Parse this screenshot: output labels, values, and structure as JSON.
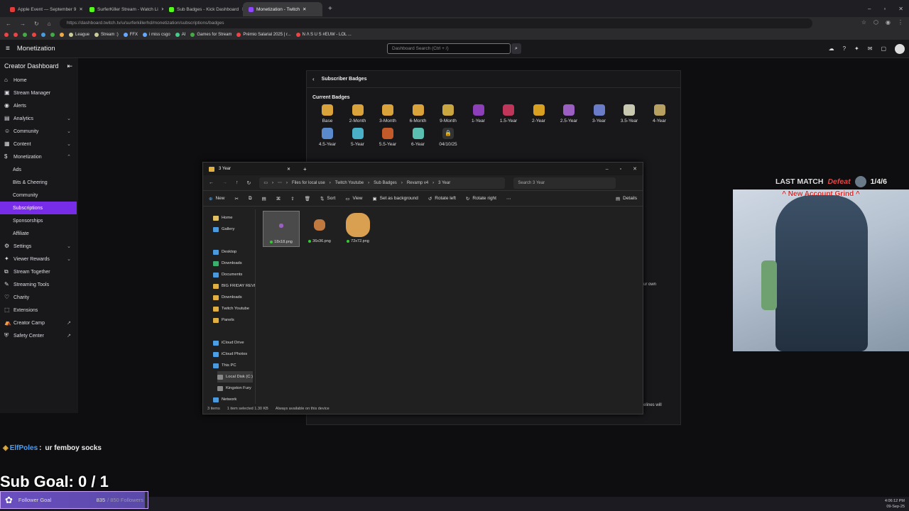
{
  "browser": {
    "tabs": [
      {
        "label": "Apple Event — September 9",
        "color": "#e43b3b"
      },
      {
        "label": "SurferKiller Stream - Watch Li",
        "color": "#53fc18"
      },
      {
        "label": "Sub Badges - Kick Dashboard",
        "color": "#53fc18"
      },
      {
        "label": "Monetization - Twitch",
        "color": "#9147ff"
      }
    ],
    "url": "https://dashboard.twitch.tv/u/surferkillerhd/monetization/subscriptions/badges",
    "bookmarks": [
      "League",
      "Stream :)",
      "FFX",
      "i miss csgo",
      "AI",
      "Games for Stream",
      "Prémio Salarial 2025 | r...",
      "N Λ S U S #EUW - LOL ..."
    ]
  },
  "twitch": {
    "header_title": "Monetization",
    "search_placeholder": "Dashboard Search (Ctrl + /)",
    "sidebar_title": "Creator Dashboard",
    "sidebar": [
      {
        "label": "Home",
        "icon": "home-icon",
        "glyph": "⌂"
      },
      {
        "label": "Stream Manager",
        "icon": "stream-manager-icon",
        "glyph": "▣"
      },
      {
        "label": "Alerts",
        "icon": "alerts-icon",
        "glyph": "◉"
      },
      {
        "label": "Analytics",
        "icon": "analytics-icon",
        "glyph": "▤",
        "chev": "⌄"
      },
      {
        "label": "Community",
        "icon": "community-icon",
        "glyph": "☺",
        "chev": "⌄"
      },
      {
        "label": "Content",
        "icon": "content-icon",
        "glyph": "▦",
        "chev": "⌄"
      },
      {
        "label": "Monetization",
        "icon": "monetization-icon",
        "glyph": "$",
        "chev": "⌃"
      },
      {
        "label": "Ads",
        "sub": true
      },
      {
        "label": "Bits & Cheering",
        "sub": true
      },
      {
        "label": "Community",
        "sub": true
      },
      {
        "label": "Subscriptions",
        "sub": true,
        "active": true
      },
      {
        "label": "Sponsorships",
        "sub": true
      },
      {
        "label": "Affiliate",
        "sub": true
      },
      {
        "label": "Settings",
        "icon": "settings-icon",
        "glyph": "⚙",
        "chev": "⌄"
      },
      {
        "label": "Viewer Rewards",
        "icon": "viewer-rewards-icon",
        "glyph": "✦",
        "chev": "⌄"
      },
      {
        "label": "Stream Together",
        "icon": "stream-together-icon",
        "glyph": "⧉"
      },
      {
        "label": "Streaming Tools",
        "icon": "streaming-tools-icon",
        "glyph": "✎"
      },
      {
        "label": "Charity",
        "icon": "charity-icon",
        "glyph": "♡"
      },
      {
        "label": "Extensions",
        "icon": "extensions-icon",
        "glyph": "⬚"
      },
      {
        "label": "Creator Camp",
        "icon": "creator-camp-icon",
        "glyph": "⛺",
        "chev": "↗"
      },
      {
        "label": "Safety Center",
        "icon": "safety-center-icon",
        "glyph": "⛨",
        "chev": "↗"
      }
    ],
    "panel_title": "Subscriber Badges",
    "current_badges_label": "Current Badges",
    "badges_row1": [
      {
        "label": "Base",
        "color": "#d9a23a"
      },
      {
        "label": "2-Month",
        "color": "#d9a23a"
      },
      {
        "label": "3-Month",
        "color": "#d9a23a"
      },
      {
        "label": "6-Month",
        "color": "#d9a23a"
      },
      {
        "label": "9-Month",
        "color": "#c9a640"
      },
      {
        "label": "1-Year",
        "color": "#8c3fb8"
      },
      {
        "label": "1.5-Year",
        "color": "#c0365a"
      },
      {
        "label": "2-Year",
        "color": "#d8a020"
      },
      {
        "label": "2.5-Year",
        "color": "#9a5fc0"
      },
      {
        "label": "3-Year",
        "color": "#6a7cc8"
      },
      {
        "label": "3.5-Year",
        "color": "#c8c8b0"
      },
      {
        "label": "4-Year",
        "color": "#b8a060"
      }
    ],
    "badges_row2": [
      {
        "label": "4.5-Year",
        "color": "#5a8acb"
      },
      {
        "label": "5-Year",
        "color": "#4ab0c8"
      },
      {
        "label": "5.5-Year",
        "color": "#c25a2a"
      },
      {
        "label": "6-Year",
        "color": "#5abfb0"
      },
      {
        "label": "04/10/25",
        "color": "#333",
        "locked": true
      }
    ],
    "panel_fragment_1": "ur own",
    "panel_fragment_2": "elines will"
  },
  "explorer": {
    "window_title": "3 Year",
    "breadcrumb": [
      "Files for local use",
      "Twitch Youtube",
      "Sub Badges",
      "Revamp v4",
      "3 Year"
    ],
    "search_placeholder": "Search 3 Year",
    "toolbar": {
      "new": "New",
      "sort": "Sort",
      "view": "View",
      "set_bg": "Set as background",
      "rotate_left": "Rotate left",
      "rotate_right": "Rotate right",
      "details": "Details"
    },
    "nav": [
      {
        "label": "Home",
        "color": "#e0c060"
      },
      {
        "label": "Gallery",
        "color": "#4a9ae0"
      },
      {
        "label": "Desktop",
        "color": "#4a9ae0"
      },
      {
        "label": "Downloads",
        "color": "#3ab070"
      },
      {
        "label": "Documents",
        "color": "#4a9ae0"
      },
      {
        "label": "BIG FRIDAY REVI",
        "color": "#e0b040"
      },
      {
        "label": "Downloads",
        "color": "#e0b040"
      },
      {
        "label": "Twitch Youtube",
        "color": "#e0b040"
      },
      {
        "label": "Panels",
        "color": "#e0b040"
      },
      {
        "label": "iCloud Drive",
        "color": "#4aa0e8"
      },
      {
        "label": "iCloud Photos",
        "color": "#4aa0e8"
      },
      {
        "label": "This PC",
        "color": "#4a9ae0"
      },
      {
        "label": "Local Disk (C:)",
        "color": "#888"
      },
      {
        "label": "Kingston Fury",
        "color": "#888"
      },
      {
        "label": "Network",
        "color": "#4a9ae0"
      }
    ],
    "files": [
      {
        "name": "18x18.png"
      },
      {
        "name": "36x36.png"
      },
      {
        "name": "72x72.png"
      }
    ],
    "status": [
      "3 items",
      "1 item selected  1.30 KB",
      "Always available on this device"
    ]
  },
  "overlay": {
    "last_match_label": "LAST MATCH",
    "last_match_result": "Defeat",
    "last_match_kda": "1/4/6",
    "cam_banner": "^ New Account Grind ^",
    "chat_user": "ElfPoles",
    "chat_message": "ur femboy socks",
    "sub_goal": "Sub Goal: 0 / 1",
    "follower_goal_label": "Follower Goal",
    "follower_current": "835",
    "follower_target": "/ 850 Followers",
    "follower_progress": 0.982,
    "clock_time": "4:06:12 PM",
    "clock_date": "09-Sep-25"
  }
}
